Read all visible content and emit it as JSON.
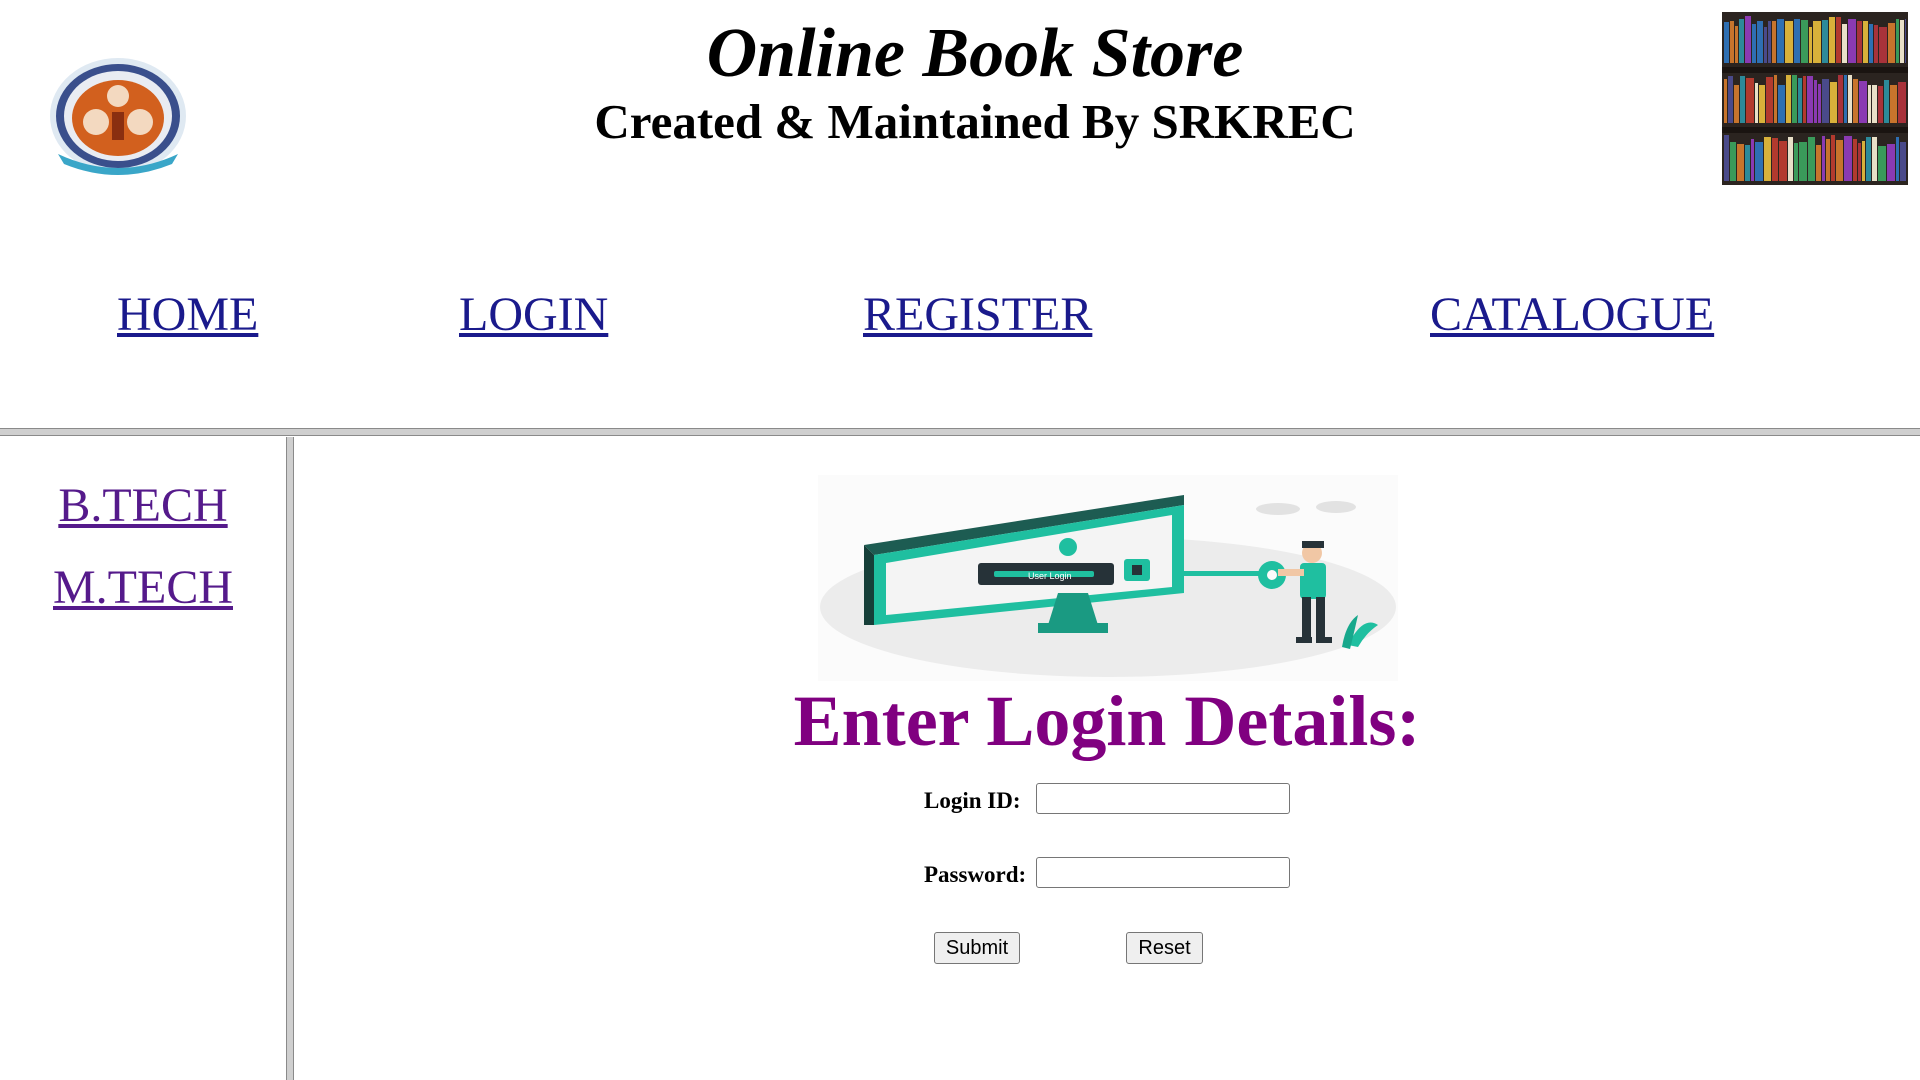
{
  "header": {
    "title": "Online Book Store",
    "subtitle": "Created & Maintained By SRKREC",
    "logo_icon": "college-emblem-icon",
    "image_icon": "bookshelf-image"
  },
  "nav": {
    "home": "HOME",
    "login": "LOGIN",
    "register": "REGISTER",
    "catalogue": "CATALOGUE"
  },
  "sidebar": {
    "btech": "B.TECH",
    "mtech": "M.TECH"
  },
  "main": {
    "illustration_icon": "user-login-illustration",
    "illustration_text": "User Login",
    "heading": "Enter Login Details:",
    "login_id_label": "Login ID:",
    "login_id_value": "",
    "password_label": "Password:",
    "password_value": "",
    "submit_label": "Submit",
    "reset_label": "Reset"
  },
  "colors": {
    "nav_link": "#1a1a8c",
    "visited_link": "#551a8b",
    "heading": "#800080",
    "accent": "#1fbfa0"
  }
}
